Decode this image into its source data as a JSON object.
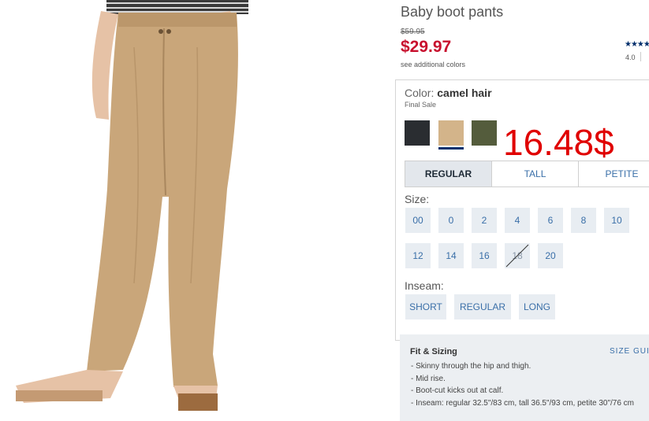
{
  "product": {
    "title": "Baby boot pants",
    "original_price": "$59.95",
    "sale_price": "$29.97",
    "see_colors": "see additional colors",
    "stars": "★★★★",
    "rating": "4.0"
  },
  "color": {
    "label": "Color:",
    "selected": "camel hair",
    "note": "Final Sale",
    "swatches": [
      {
        "name": "black",
        "hex": "#2a2d31"
      },
      {
        "name": "camel hair",
        "hex": "#d3b48a",
        "selected": true
      },
      {
        "name": "olive",
        "hex": "#545c3c"
      }
    ]
  },
  "annotation": "16.48$",
  "fit_tabs": [
    "REGULAR",
    "TALL",
    "PETITE"
  ],
  "size": {
    "label": "Size:",
    "options": [
      "00",
      "0",
      "2",
      "4",
      "6",
      "8",
      "10",
      "12",
      "14",
      "16",
      "18",
      "20"
    ],
    "unavailable": [
      "18"
    ]
  },
  "inseam": {
    "label": "Inseam:",
    "options": [
      "SHORT",
      "REGULAR",
      "LONG"
    ]
  },
  "fit_sizing": {
    "title": "Fit & Sizing",
    "guide_link": "SIZE GUI",
    "bullets": [
      "- Skinny through the hip and thigh.",
      "- Mid rise.",
      "- Boot-cut kicks out at calf.",
      "- Inseam: regular 32.5\"/83 cm, tall 36.5\"/93 cm, petite 30\"/76 cm"
    ]
  },
  "colors": {
    "sale_red": "#c8102e",
    "link_blue": "#3a6fa8",
    "navy": "#002f6c",
    "annotation_red": "#e00000"
  }
}
